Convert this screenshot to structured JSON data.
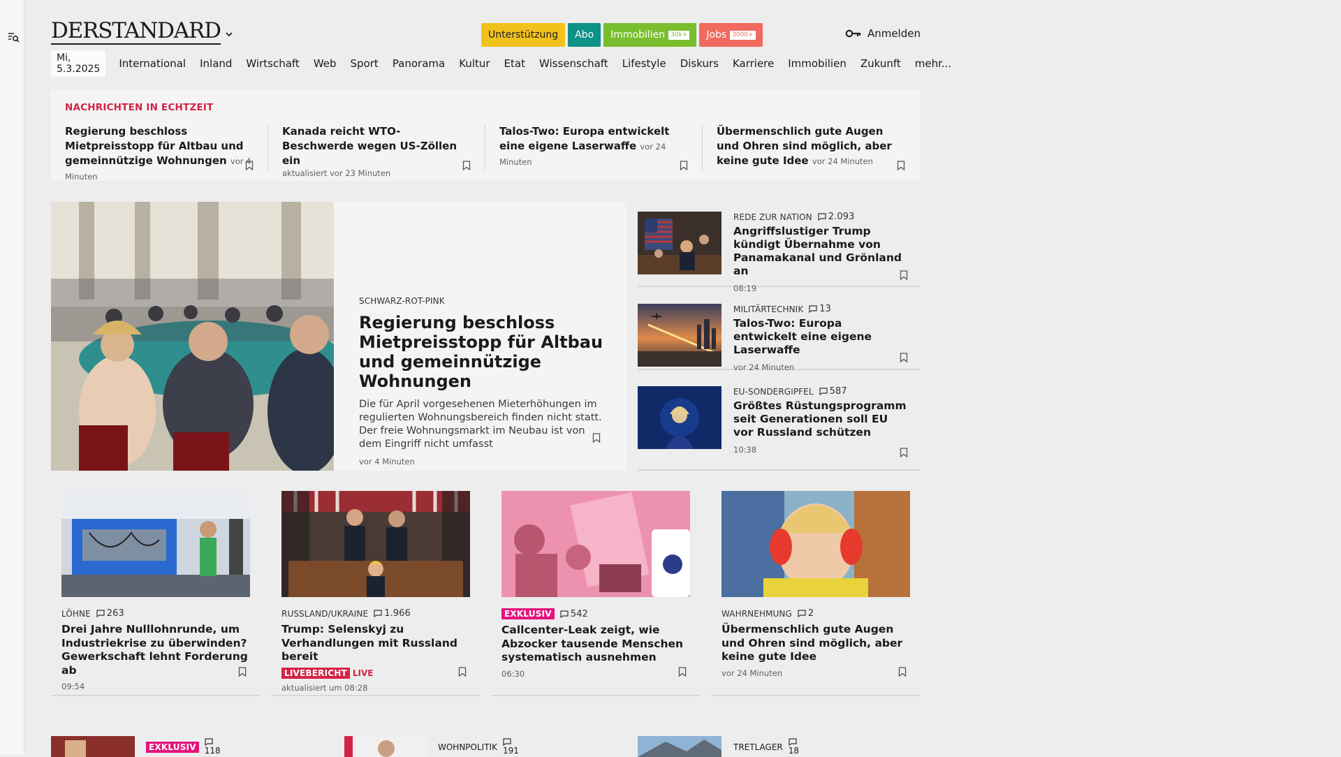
{
  "brand": {
    "logo": "DERSTANDARD"
  },
  "header": {
    "pills": [
      {
        "label": "Unterstützung"
      },
      {
        "label": "Abo"
      },
      {
        "label": "Immobilien",
        "tag": "30k+"
      },
      {
        "label": "Jobs",
        "tag": "3000+"
      }
    ],
    "login_label": "Anmelden"
  },
  "nav": {
    "date": "Mi, 5.3.2025",
    "items": [
      "International",
      "Inland",
      "Wirtschaft",
      "Web",
      "Sport",
      "Panorama",
      "Kultur",
      "Etat",
      "Wissenschaft",
      "Lifestyle",
      "Diskurs",
      "Karriere",
      "Immobilien",
      "Zukunft",
      "mehr..."
    ]
  },
  "ticker": {
    "title": "NACHRICHTEN IN ECHTZEIT",
    "items": [
      {
        "title": "Regierung beschloss Mietpreisstopp für Altbau und gemeinnützige Wohnungen",
        "time": "vor 4 Minuten"
      },
      {
        "title": "Kanada reicht WTO-Beschwerde wegen US-Zöllen ein",
        "time": "aktualisiert vor 23 Minuten"
      },
      {
        "title": "Talos-Two: Europa entwickelt eine eigene Laserwaffe",
        "time": "vor 24 Minuten"
      },
      {
        "title": "Übermenschlich gute Augen und Ohren sind möglich, aber keine gute Idee",
        "time": "vor 24 Minuten"
      }
    ]
  },
  "hero": {
    "kicker": "SCHWARZ-ROT-PINK",
    "title": "Regierung beschloss Mietpreisstopp für Altbau und gemeinnützige Wohnungen",
    "teaser": "Die für April vorgesehenen Mieterhöhungen im regulierten Wohnungsbereich finden nicht statt. Der freie Wohnungsmarkt im Neubau ist von dem Eingriff nicht umfasst",
    "time": "vor 4 Minuten"
  },
  "side": [
    {
      "kicker": "REDE ZUR NATION",
      "comments": "2.093",
      "title": "Angriffslustiger Trump kündigt Übernahme von Panamakanal und Grönland an",
      "time": "08:19"
    },
    {
      "kicker": "MILITÄRTECHNIK",
      "comments": "13",
      "title": "Talos-Two: Europa entwickelt eine eigene Laserwaffe",
      "time": "vor 24 Minuten"
    },
    {
      "kicker": "EU-SONDERGIPFEL",
      "comments": "587",
      "title": "Größtes Rüstungsprogramm seit Generationen soll EU vor Russland schützen",
      "time": "10:38"
    }
  ],
  "cards": [
    {
      "kicker": "LÖHNE",
      "comments": "263",
      "title": "Drei Jahre Nulllohnrunde, um Industriekrise zu überwinden? Gewerkschaft lehnt Forderung ab",
      "time": "09:54"
    },
    {
      "kicker": "RUSSLAND/UKRAINE",
      "comments": "1.966",
      "title": "Trump: Selenskyj zu Verhandlungen mit Russland bereit",
      "badge": "LIVEBERICHT",
      "live": "LIVE",
      "time": "aktualisiert um 08:28"
    },
    {
      "badge": "EXKLUSIV",
      "comments": "542",
      "title": "Callcenter-Leak zeigt, wie Abzocker tausende Menschen systematisch ausnehmen",
      "time": "06:30"
    },
    {
      "kicker": "WAHRNEHMUNG",
      "comments": "2",
      "title": "Übermenschlich gute Augen und Ohren sind möglich, aber keine gute Idee",
      "time": "vor 24 Minuten"
    }
  ],
  "bottom": [
    {
      "badge": "EXKLUSIV",
      "comments": "118"
    },
    {
      "kicker": "WOHNPOLITIK",
      "comments": "191"
    },
    {
      "kicker": "TRETLAGER",
      "comments": "18"
    }
  ],
  "colors": {
    "accent_red": "#d32346",
    "exclusive_pink": "#e5127d",
    "abo_teal": "#0c9287"
  }
}
